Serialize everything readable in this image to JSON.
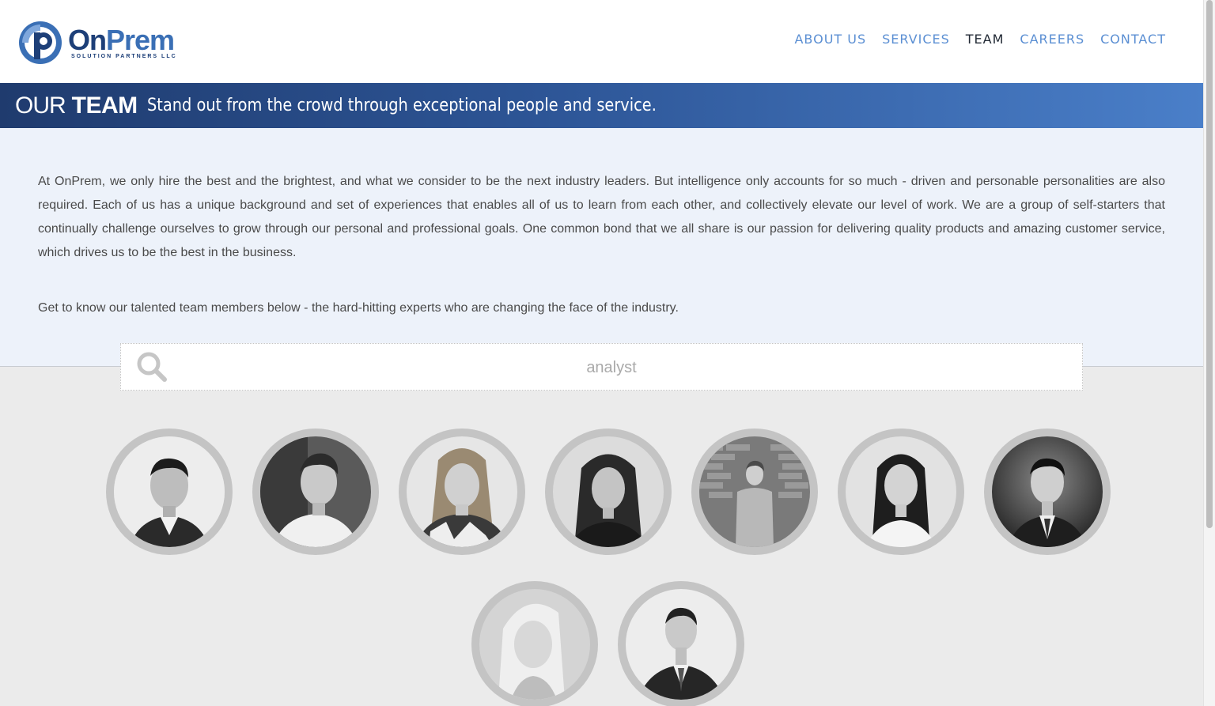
{
  "brand": {
    "name_part1": "On",
    "name_part2": "Prem",
    "tagline": "SOLUTION PARTNERS LLC",
    "logo_icon": "onprem-logo-icon",
    "primary_color": "#3a6fb5",
    "dark_color": "#1d3f78"
  },
  "nav": {
    "items": [
      {
        "label": "ABOUT US",
        "active": false
      },
      {
        "label": "SERVICES",
        "active": false
      },
      {
        "label": "TEAM",
        "active": true
      },
      {
        "label": "CAREERS",
        "active": false
      },
      {
        "label": "CONTACT",
        "active": false
      }
    ],
    "link_color": "#5b8fd3",
    "active_color": "#222a35"
  },
  "banner": {
    "prefix": "OUR",
    "title": "TEAM",
    "tagline": "Stand out from the crowd through exceptional people and service."
  },
  "intro": {
    "paragraph1": "At OnPrem, we only hire the best and the brightest, and what we consider to be the next industry leaders. But intelligence only accounts for so much - driven and personable personalities are also required. Each of us has a unique background and set of experiences that enables all of us to learn from each other, and collectively elevate our level of work. We are a group of self-starters that continually challenge ourselves to grow through our personal and professional goals. One common bond that we all share is our passion for delivering quality products and amazing customer service, which drives us to be the best in the business.",
    "paragraph2": "Get to know our talented team members below - the hard-hitting experts who are changing the face of the industry."
  },
  "search": {
    "icon": "search-icon",
    "value": "analyst"
  },
  "team": {
    "members": [
      {
        "photo": "team-member-photo"
      },
      {
        "photo": "team-member-photo"
      },
      {
        "photo": "team-member-photo"
      },
      {
        "photo": "team-member-photo"
      },
      {
        "photo": "team-member-photo"
      },
      {
        "photo": "team-member-photo"
      },
      {
        "photo": "team-member-photo"
      },
      {
        "photo": "team-member-photo"
      },
      {
        "photo": "team-member-photo"
      }
    ]
  }
}
